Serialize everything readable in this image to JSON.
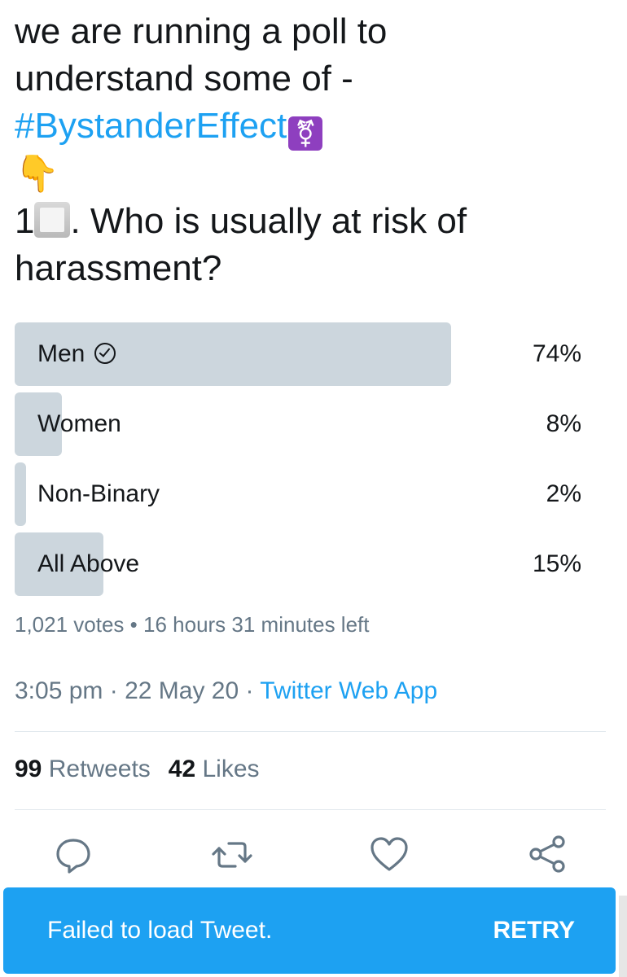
{
  "tweet": {
    "line1": "we are running a poll to",
    "line2": "understand some of -",
    "hashtag": "#BystanderEffect",
    "transgender_symbol": "⚧",
    "pointing_emoji": "👇",
    "question_number": "1",
    "question_text": ". Who is usually at risk of",
    "question_line2": "harassment?"
  },
  "poll": {
    "options": [
      {
        "label": "Men",
        "percent_label": "74%",
        "percent": 74,
        "selected": true
      },
      {
        "label": "Women",
        "percent_label": "8%",
        "percent": 8,
        "selected": false
      },
      {
        "label": "Non-Binary",
        "percent_label": "2%",
        "percent": 2,
        "selected": false
      },
      {
        "label": "All Above",
        "percent_label": "15%",
        "percent": 15,
        "selected": false
      }
    ],
    "votes": "1,021 votes",
    "time_left": "16 hours 31 minutes left",
    "fill_color": "#ccd6dd"
  },
  "meta": {
    "time": "3:05 pm",
    "date": "22 May 20",
    "source": "Twitter Web App"
  },
  "stats": {
    "retweets_count": "99",
    "retweets_label": "Retweets",
    "likes_count": "42",
    "likes_label": "Likes"
  },
  "actions": [
    {
      "name": "reply-icon"
    },
    {
      "name": "retweet-icon"
    },
    {
      "name": "like-icon"
    },
    {
      "name": "share-icon"
    }
  ],
  "toast": {
    "message": "Failed to load Tweet.",
    "action_label": "RETRY"
  },
  "colors": {
    "accent": "#1da1f2",
    "text": "#14171a",
    "muted": "#657786"
  }
}
